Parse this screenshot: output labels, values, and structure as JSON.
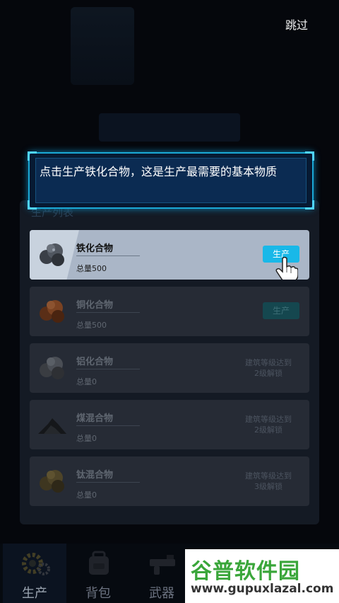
{
  "header": {
    "skip_label": "跳过"
  },
  "guide": {
    "tip_text": "点击生产铁化合物，这是生产最需要的基本物质"
  },
  "panel": {
    "title": "生产列表",
    "items": [
      {
        "name": "铁化合物",
        "amount": "总量500",
        "action": "生产",
        "state": "active",
        "ore": "iron-ore-icon"
      },
      {
        "name": "铜化合物",
        "amount": "总量500",
        "action": "生产",
        "state": "dim",
        "ore": "copper-ore-icon"
      },
      {
        "name": "铝化合物",
        "amount": "总量0",
        "lock_line1": "建筑等级达到",
        "lock_line2": "2级解锁",
        "state": "locked",
        "ore": "aluminum-ore-icon"
      },
      {
        "name": "煤混合物",
        "amount": "总量0",
        "lock_line1": "建筑等级达到",
        "lock_line2": "2级解锁",
        "state": "locked",
        "ore": "coal-pile-icon"
      },
      {
        "name": "钛混合物",
        "amount": "总量0",
        "lock_line1": "建筑等级达到",
        "lock_line2": "3级解锁",
        "state": "locked",
        "ore": "titanium-ore-icon"
      }
    ]
  },
  "bottom_nav": {
    "tabs": [
      {
        "label": "生产",
        "icon": "gear-icon"
      },
      {
        "label": "背包",
        "icon": "backpack-icon"
      },
      {
        "label": "武器",
        "icon": "weapon-icon"
      }
    ]
  },
  "watermark": {
    "brand": "谷普软件园",
    "url": "www.gupuxlazal.com"
  },
  "colors": {
    "accent": "#19b8e8",
    "frame": "#1aa9d6",
    "panel": "#141a24",
    "active_row": "#aab6c7"
  }
}
